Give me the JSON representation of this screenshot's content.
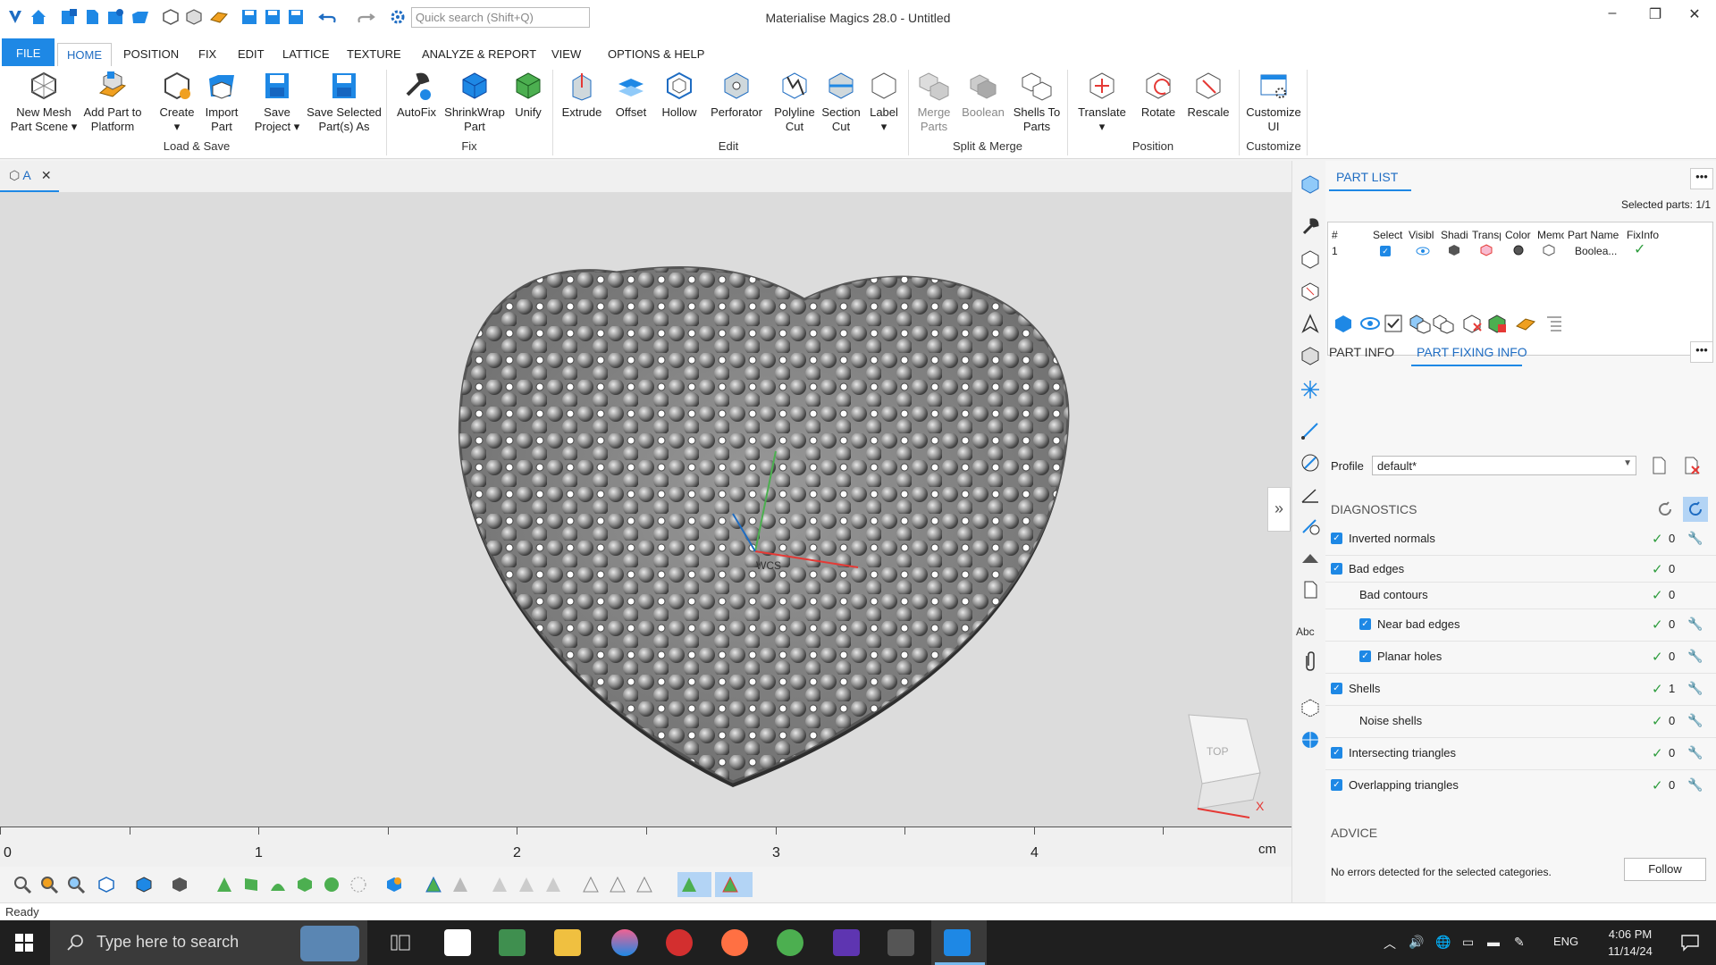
{
  "window": {
    "title": "Materialise Magics 28.0 - Untitled",
    "search_placeholder": "Quick search (Shift+Q)",
    "minimize": "–",
    "maximize": "❐",
    "close": "✕"
  },
  "ribbon_tabs": [
    "FILE",
    "HOME",
    "POSITION",
    "FIX",
    "EDIT",
    "LATTICE",
    "TEXTURE",
    "ANALYZE & REPORT",
    "VIEW",
    "OPTIONS & HELP"
  ],
  "ribbon": {
    "buttons": [
      {
        "label": "New Mesh\nPart Scene ▾",
        "icon": "new-mesh-icon"
      },
      {
        "label": "Add Part to\nPlatform",
        "icon": "add-part-icon"
      },
      {
        "label": "Create\n▾",
        "icon": "create-icon"
      },
      {
        "label": "Import\nPart",
        "icon": "import-part-icon"
      },
      {
        "label": "Save\nProject ▾",
        "icon": "save-project-icon"
      },
      {
        "label": "Save Selected\nPart(s) As",
        "icon": "save-selected-icon"
      },
      {
        "label": "AutoFix",
        "icon": "autofix-icon"
      },
      {
        "label": "ShrinkWrap\nPart",
        "icon": "shrinkwrap-icon"
      },
      {
        "label": "Unify",
        "icon": "unify-icon"
      },
      {
        "label": "Extrude",
        "icon": "extrude-icon"
      },
      {
        "label": "Offset",
        "icon": "offset-icon"
      },
      {
        "label": "Hollow",
        "icon": "hollow-icon"
      },
      {
        "label": "Perforator",
        "icon": "perforator-icon"
      },
      {
        "label": "Polyline\nCut",
        "icon": "polyline-cut-icon"
      },
      {
        "label": "Section\nCut",
        "icon": "section-cut-icon"
      },
      {
        "label": "Label\n▾",
        "icon": "label-icon"
      },
      {
        "label": "Merge\nParts",
        "icon": "merge-parts-icon"
      },
      {
        "label": "Boolean",
        "icon": "boolean-icon"
      },
      {
        "label": "Shells To\nParts",
        "icon": "shells-to-parts-icon"
      },
      {
        "label": "Translate\n▾",
        "icon": "translate-icon"
      },
      {
        "label": "Rotate",
        "icon": "rotate-icon"
      },
      {
        "label": "Rescale",
        "icon": "rescale-icon"
      },
      {
        "label": "Customize\nUI",
        "icon": "customize-ui-icon"
      }
    ],
    "groups": [
      "Load & Save",
      "Fix",
      "Edit",
      "Split & Merge",
      "Position",
      "Customize"
    ]
  },
  "document_tab": {
    "label": "A",
    "close": "✕"
  },
  "viewport": {
    "axis_label": "WCS",
    "cube_label": "TOP",
    "axis_x": "X"
  },
  "ruler": {
    "labels": [
      "0",
      "1",
      "2",
      "3",
      "4"
    ],
    "unit": "cm"
  },
  "status": {
    "text": "Ready"
  },
  "part_list": {
    "title": "PART LIST",
    "more": "•••",
    "selected_parts": "Selected parts:  1/1",
    "columns": [
      "#",
      "Select",
      "Visibl",
      "Shadi",
      "Transp",
      "Color",
      "Memo",
      "Part Name",
      "FixInfo"
    ],
    "rows": [
      {
        "num": "1",
        "part_name": "Boolea..."
      }
    ]
  },
  "info_tabs": [
    "PART INFO",
    "PART FIXING INFO"
  ],
  "fixing": {
    "profile_label": "Profile",
    "profile_value": "default*",
    "diagnostics_title": "DIAGNOSTICS",
    "items": [
      {
        "label": "Inverted normals",
        "count": "0",
        "checkbox": true,
        "indent": 0,
        "fix": true
      },
      {
        "label": "Bad edges",
        "count": "0",
        "checkbox": true,
        "indent": 0,
        "fix": false
      },
      {
        "label": "Bad contours",
        "count": "0",
        "checkbox": false,
        "indent": 1,
        "fix": false
      },
      {
        "label": "Near bad edges",
        "count": "0",
        "checkbox": true,
        "indent": 2,
        "fix": true
      },
      {
        "label": "Planar holes",
        "count": "0",
        "checkbox": true,
        "indent": 2,
        "fix": true
      },
      {
        "label": "Shells",
        "count": "1",
        "checkbox": true,
        "indent": 0,
        "fix": true
      },
      {
        "label": "Noise shells",
        "count": "0",
        "checkbox": false,
        "indent": 1,
        "fix": true
      },
      {
        "label": "Intersecting triangles",
        "count": "0",
        "checkbox": true,
        "indent": 0,
        "fix": true
      },
      {
        "label": "Overlapping triangles",
        "count": "0",
        "checkbox": true,
        "indent": 0,
        "fix": true
      }
    ],
    "advice_title": "ADVICE",
    "advice_text": "No errors detected for the selected categories.",
    "follow_button": "Follow"
  },
  "taskbar": {
    "search_placeholder": "Type here to search",
    "language": "ENG",
    "time": "4:06 PM",
    "date": "11/14/24"
  },
  "colors": {
    "accent": "#1e88e5",
    "ok_green": "#2e9d3e",
    "viewport_bg": "#dcdcdc"
  }
}
